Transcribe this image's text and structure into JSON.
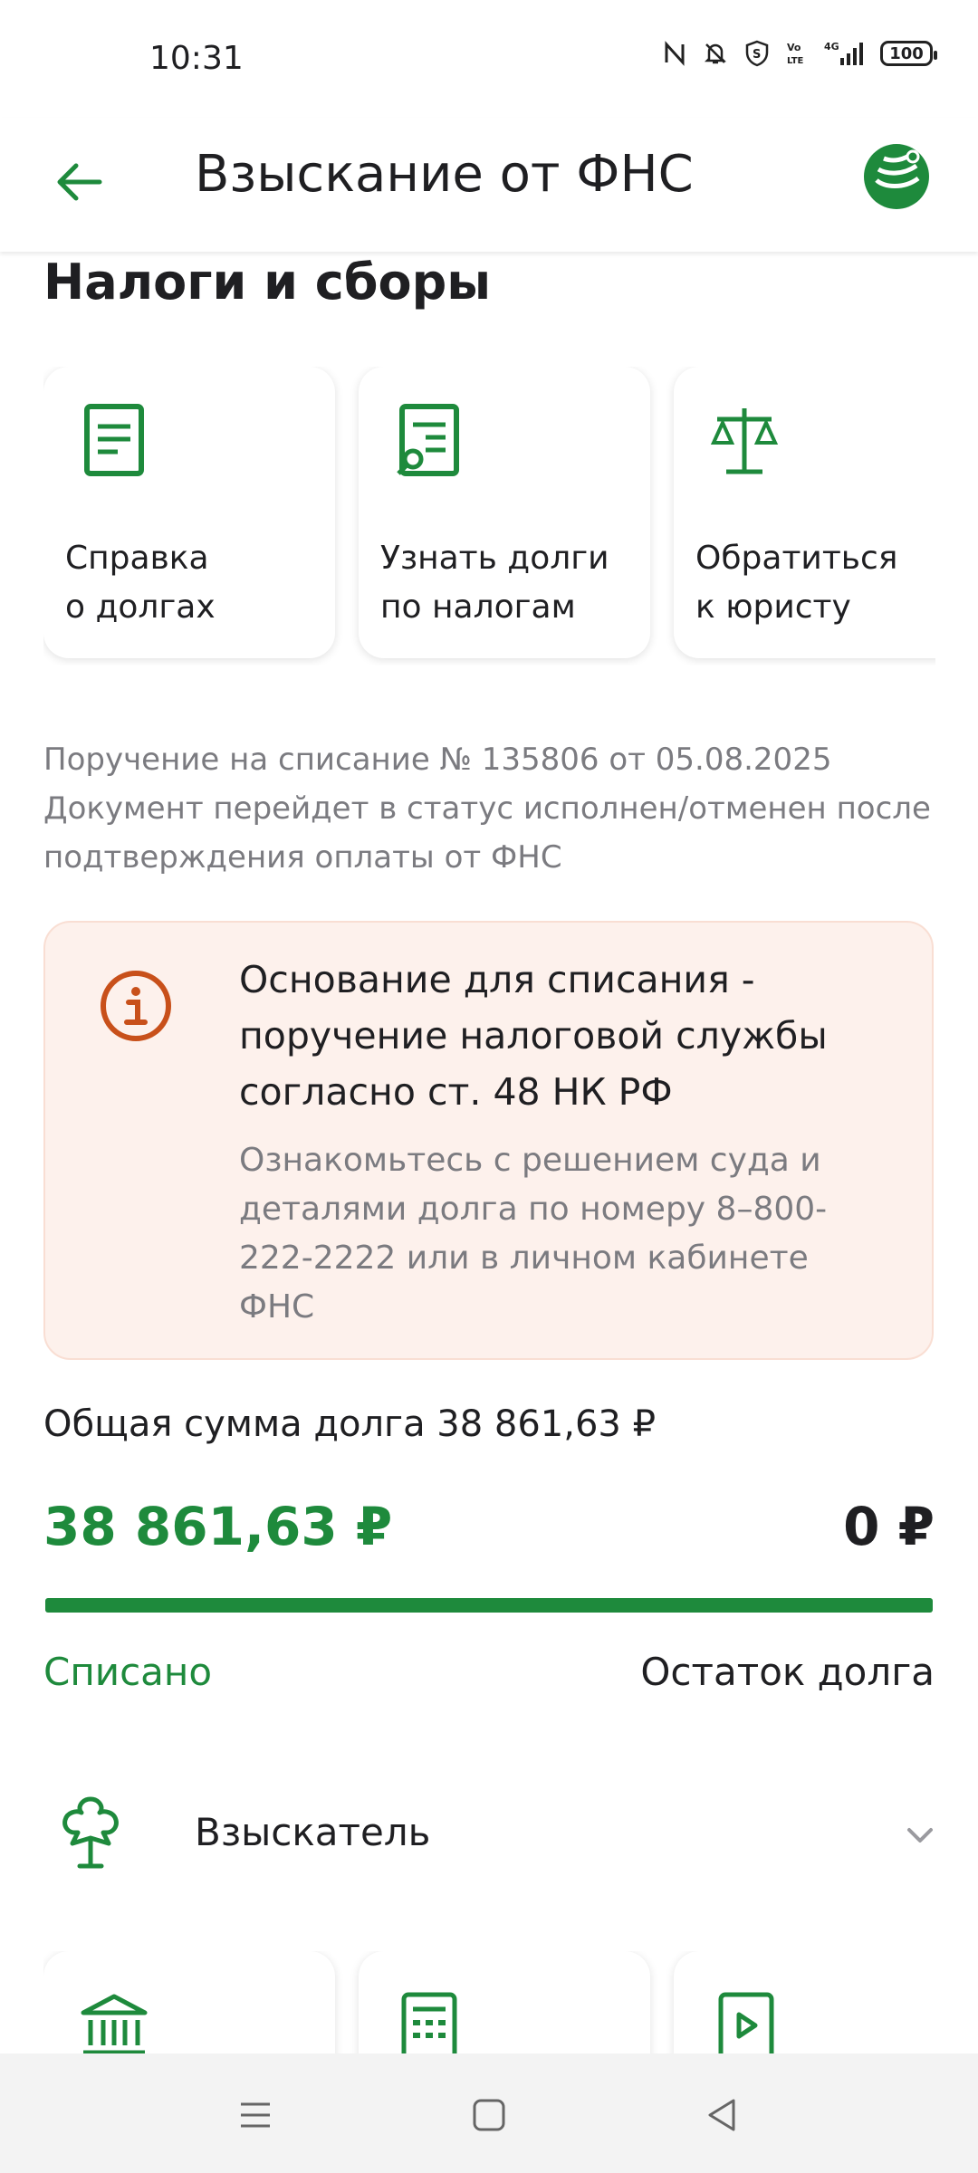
{
  "status_bar": {
    "time": "10:31",
    "battery": "100"
  },
  "header": {
    "title": "Взыскание от ФНС"
  },
  "section": {
    "title": "Налоги и сборы"
  },
  "quick_actions": [
    {
      "label": "Справка\nо долгах",
      "icon": "document-icon"
    },
    {
      "label": "Узнать долги\nпо налогам",
      "icon": "document-search-icon"
    },
    {
      "label": "Обратиться\nк юристу",
      "icon": "scales-icon"
    }
  ],
  "order_info": {
    "line1": "Поручение на списание № 135806 от 05.08.2025",
    "line2": "Документ перейдет в статус исполнен/отменен после",
    "line3": "подтверждения оплаты от ФНС"
  },
  "notice": {
    "title": "Основание для списания - поручение налоговой службы согласно ст. 48 НК РФ",
    "body": "Ознакомьтесь с решением суда и деталями долга по номеру 8–800-222-2222 или в личном кабинете ФНС"
  },
  "debt": {
    "total_text": "Общая сумма долга 38 861,63 ₽",
    "paid_amount": "38 861,63 ₽",
    "remaining_amount": "0 ₽",
    "paid_label": "Списано",
    "remaining_label": "Остаток долга",
    "progress_paid_percent": 100
  },
  "collector": {
    "label": "Взыскатель",
    "icon": "emblem-icon"
  },
  "bottom_cards": [
    {
      "icon": "bank-icon"
    },
    {
      "icon": "calculator-icon"
    },
    {
      "icon": "video-play-icon"
    }
  ],
  "colors": {
    "accent": "#1e8a3c",
    "notice_bg": "#fdf1ec",
    "notice_icon": "#c8501a",
    "muted_text": "#7b7b80"
  }
}
